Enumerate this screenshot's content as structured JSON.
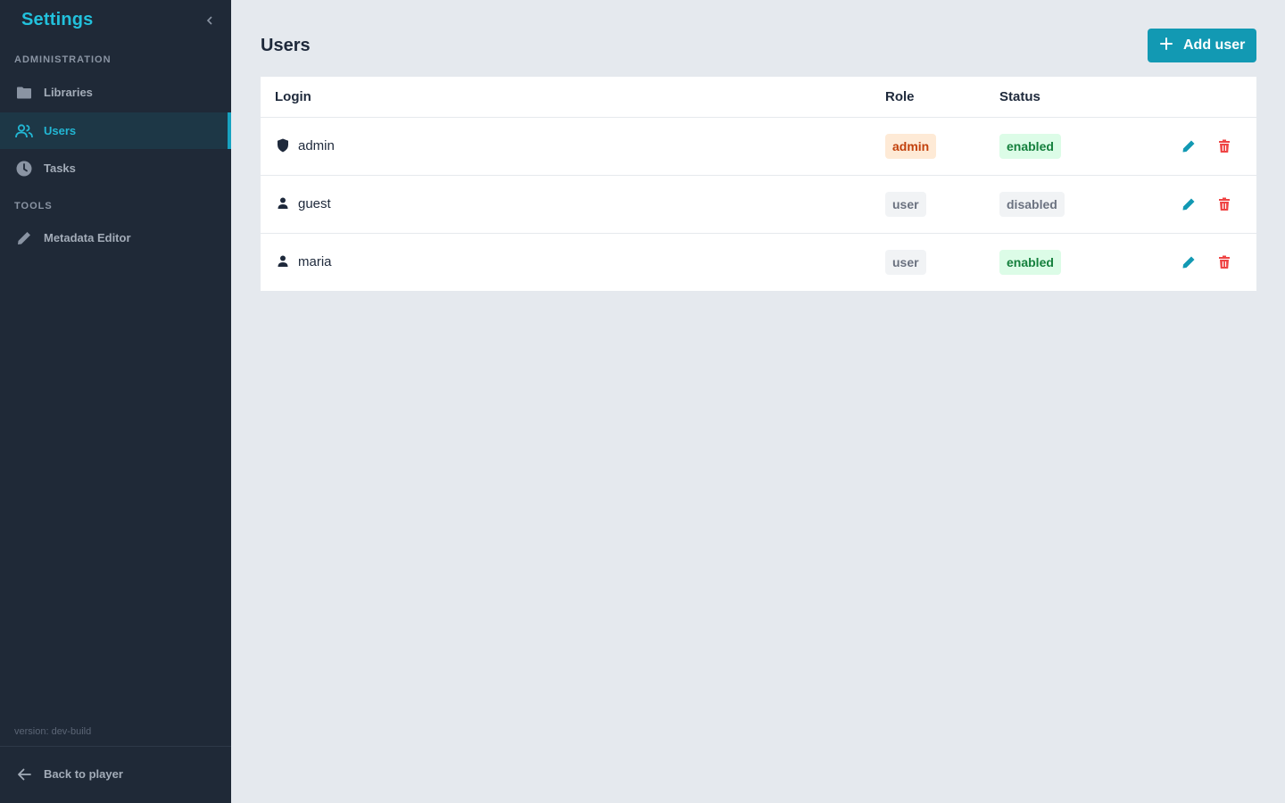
{
  "sidebar": {
    "title": "Settings",
    "collapse_icon": "chevron-left-icon",
    "sections": [
      {
        "label": "ADMINISTRATION",
        "items": [
          {
            "label": "Libraries",
            "icon": "folder-icon",
            "active": false
          },
          {
            "label": "Users",
            "icon": "users-icon",
            "active": true
          },
          {
            "label": "Tasks",
            "icon": "clock-icon",
            "active": false
          }
        ]
      },
      {
        "label": "TOOLS",
        "items": [
          {
            "label": "Metadata Editor",
            "icon": "pencil-icon",
            "active": false
          }
        ]
      }
    ],
    "version": "version: dev-build",
    "back_label": "Back to player",
    "back_icon": "arrow-left-icon"
  },
  "main": {
    "title": "Users",
    "add_button": {
      "label": "Add user",
      "icon": "plus-icon"
    },
    "table": {
      "columns": [
        "Login",
        "Role",
        "Status"
      ],
      "rows": [
        {
          "login": "admin",
          "icon": "shield-icon",
          "role": "admin",
          "status": "enabled"
        },
        {
          "login": "guest",
          "icon": "person-icon",
          "role": "user",
          "status": "disabled"
        },
        {
          "login": "maria",
          "icon": "person-icon",
          "role": "user",
          "status": "enabled"
        }
      ],
      "row_actions": [
        "edit-icon",
        "delete-icon"
      ]
    }
  },
  "colors": {
    "accent": "#1299b3",
    "sidebar_bg": "#1f2937",
    "page_bg": "#e5e9ee",
    "danger": "#ef4444"
  }
}
